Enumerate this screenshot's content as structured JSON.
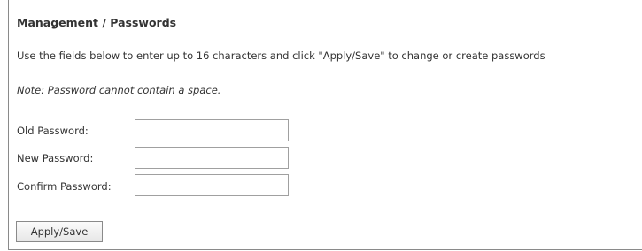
{
  "page": {
    "title": "Management / Passwords",
    "description": "Use the fields below to enter up to 16 characters and click \"Apply/Save\" to change or create passwords",
    "note": "Note: Password cannot contain a space."
  },
  "form": {
    "old_password": {
      "label": "Old Password:",
      "value": ""
    },
    "new_password": {
      "label": "New Password:",
      "value": ""
    },
    "confirm_password": {
      "label": "Confirm Password:",
      "value": ""
    }
  },
  "actions": {
    "apply_save_label": "Apply/Save"
  }
}
